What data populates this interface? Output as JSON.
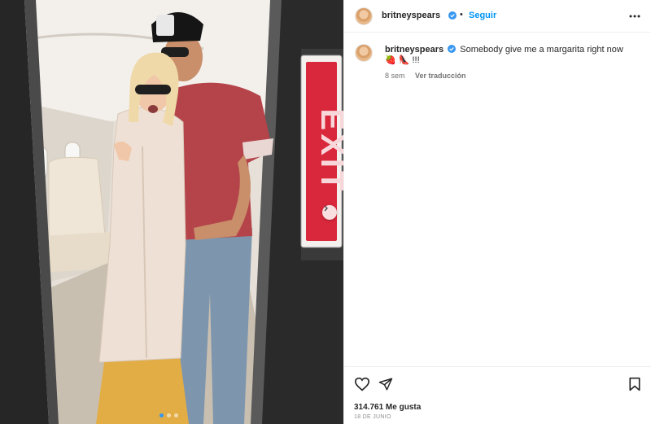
{
  "post": {
    "author": {
      "username": "britneyspears",
      "verified": true
    },
    "header": {
      "separator": "•",
      "follow_label": "Seguir",
      "more_icon": "more-horizontal-icon"
    },
    "caption": {
      "username": "britneyspears",
      "text": "Somebody give me a margarita right now 🍓 👠 !!!"
    },
    "meta": {
      "time_ago": "8 sem",
      "translate_label": "Ver traducción"
    },
    "actions": {
      "like_icon": "heart-icon",
      "share_icon": "paper-plane-icon",
      "save_icon": "bookmark-icon"
    },
    "likes_text": "314.761 Me gusta",
    "date_text": "18 DE JUNIO",
    "media": {
      "exit_sign_text": "EXIT",
      "next_icon": "chevron-right-icon",
      "carousel_count": 3,
      "carousel_active": 0
    }
  },
  "colors": {
    "accent": "#0095f6",
    "verified": "#3897f0",
    "exit_red": "#d9283b"
  }
}
